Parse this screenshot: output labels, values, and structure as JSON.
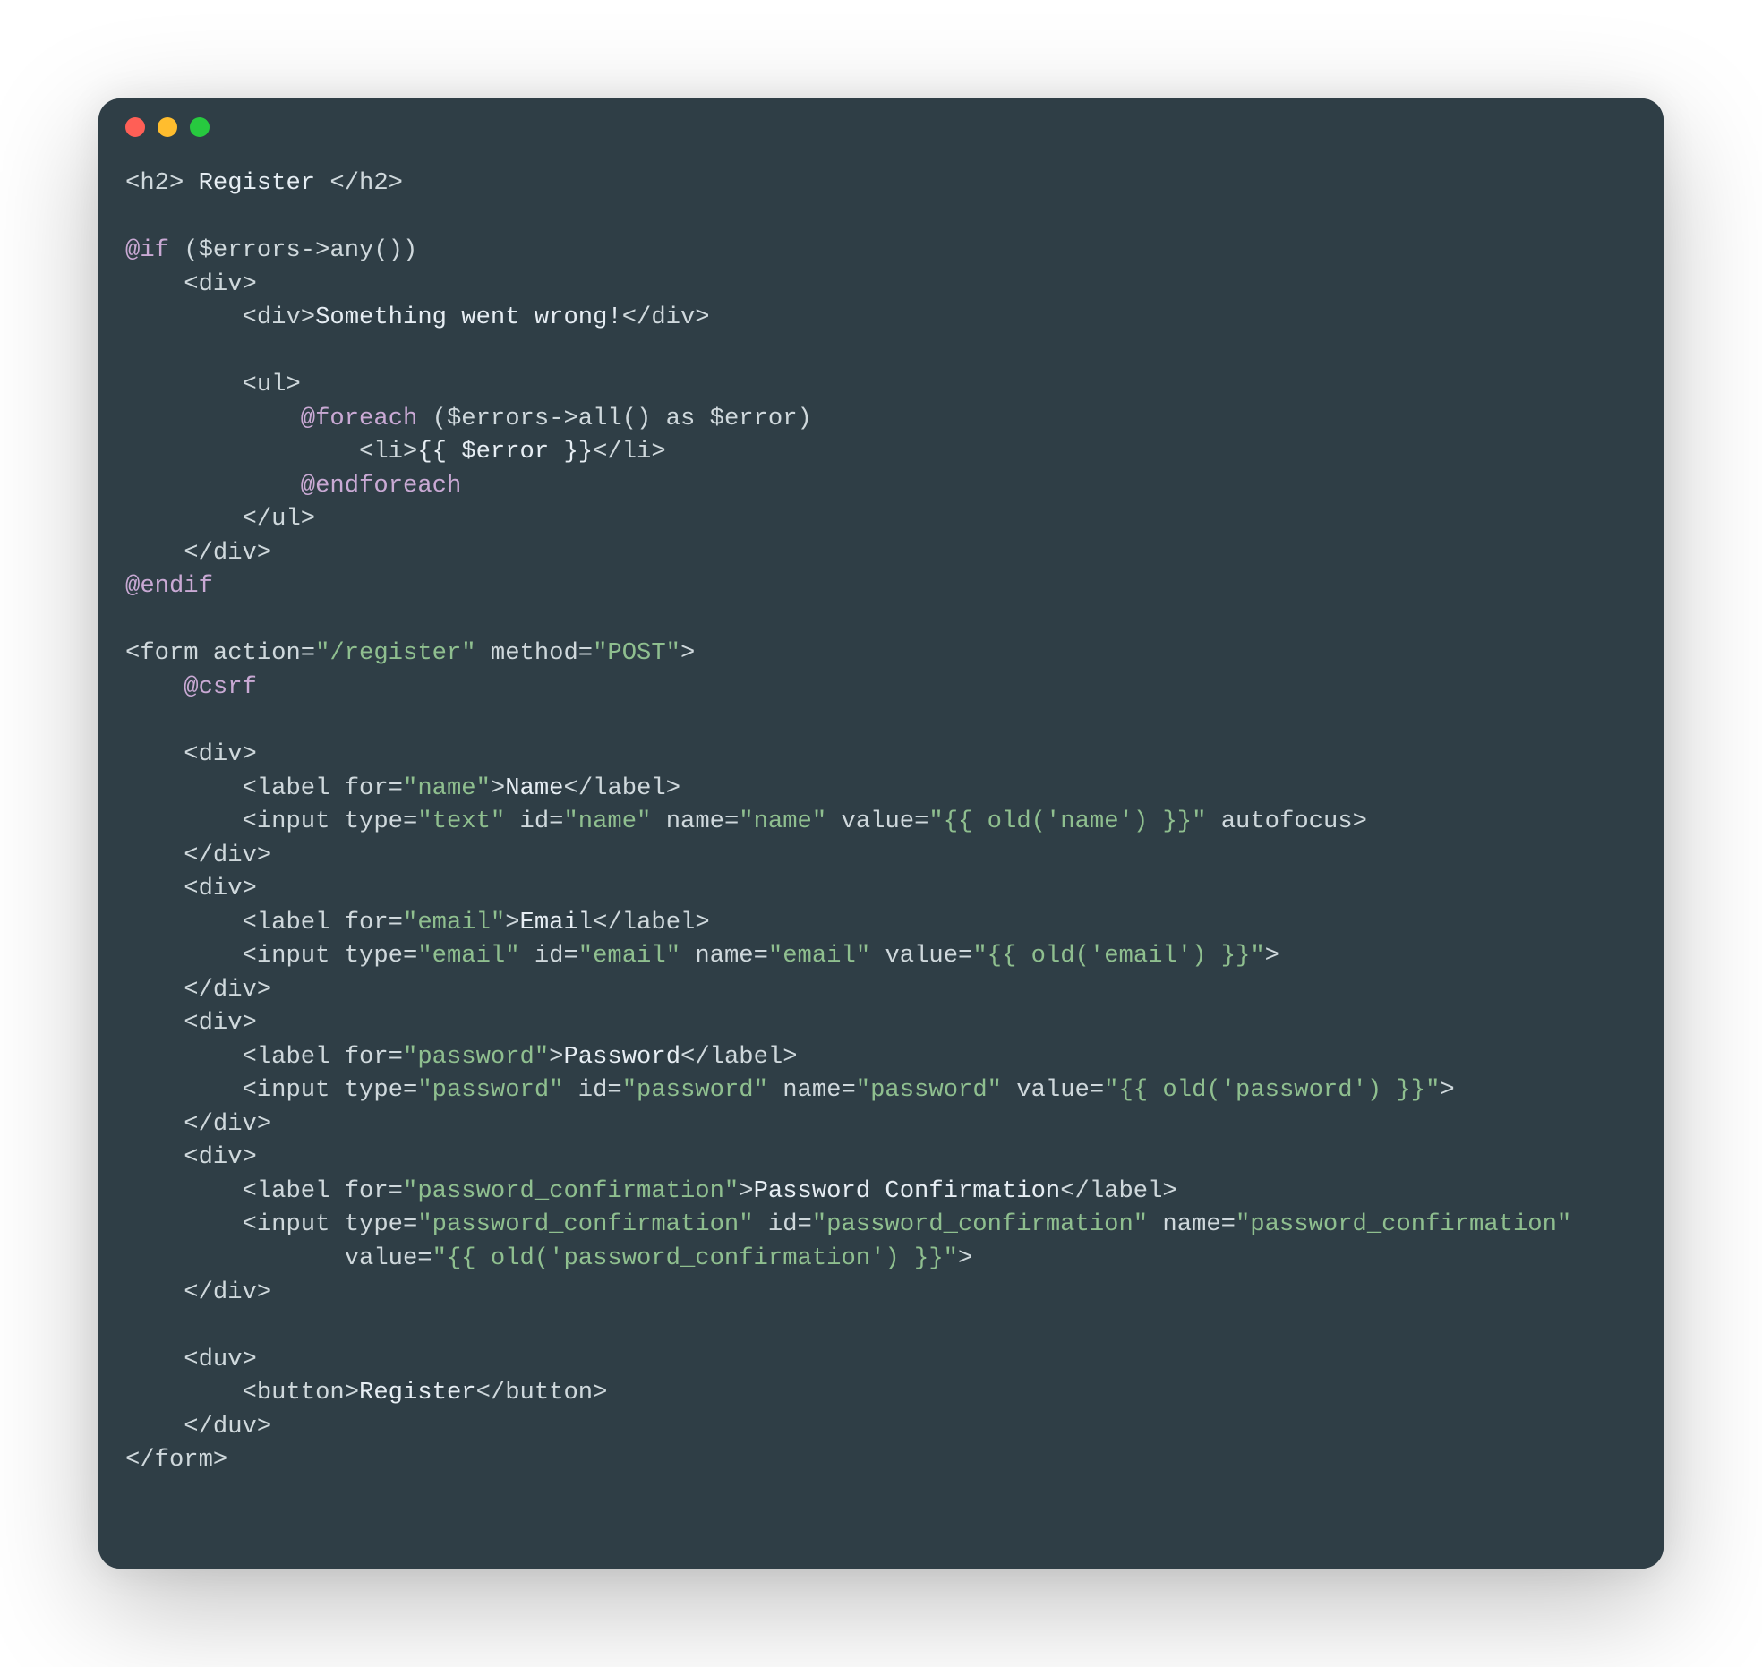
{
  "window": {
    "traffic_lights": [
      "close",
      "minimize",
      "maximize"
    ]
  },
  "code": {
    "lines": [
      [
        {
          "t": "<h2>",
          "c": "c-tag"
        },
        {
          "t": " Register ",
          "c": "c-white"
        },
        {
          "t": "</h2>",
          "c": "c-tag"
        }
      ],
      [],
      [
        {
          "t": "@if",
          "c": "c-dir"
        },
        {
          "t": " ($errors->any())",
          "c": "c-default"
        }
      ],
      [
        {
          "t": "    <div>",
          "c": "c-tag"
        }
      ],
      [
        {
          "t": "        <div>",
          "c": "c-tag"
        },
        {
          "t": "Something went wrong!",
          "c": "c-white"
        },
        {
          "t": "</div>",
          "c": "c-tag"
        }
      ],
      [],
      [
        {
          "t": "        <ul>",
          "c": "c-tag"
        }
      ],
      [
        {
          "t": "            ",
          "c": "c-default"
        },
        {
          "t": "@foreach",
          "c": "c-dir"
        },
        {
          "t": " ($errors->all() as $error)",
          "c": "c-default"
        }
      ],
      [
        {
          "t": "                <li>",
          "c": "c-tag"
        },
        {
          "t": "{{ $error }}",
          "c": "c-white"
        },
        {
          "t": "</li>",
          "c": "c-tag"
        }
      ],
      [
        {
          "t": "            ",
          "c": "c-default"
        },
        {
          "t": "@endforeach",
          "c": "c-dir"
        }
      ],
      [
        {
          "t": "        </ul>",
          "c": "c-tag"
        }
      ],
      [
        {
          "t": "    </div>",
          "c": "c-tag"
        }
      ],
      [
        {
          "t": "@endif",
          "c": "c-dir"
        }
      ],
      [],
      [
        {
          "t": "<form action=",
          "c": "c-tag"
        },
        {
          "t": "\"/register\"",
          "c": "c-str"
        },
        {
          "t": " method=",
          "c": "c-attr"
        },
        {
          "t": "\"POST\"",
          "c": "c-str"
        },
        {
          "t": ">",
          "c": "c-tag"
        }
      ],
      [
        {
          "t": "    ",
          "c": "c-default"
        },
        {
          "t": "@csrf",
          "c": "c-dir"
        }
      ],
      [],
      [
        {
          "t": "    <div>",
          "c": "c-tag"
        }
      ],
      [
        {
          "t": "        <label for=",
          "c": "c-tag"
        },
        {
          "t": "\"name\"",
          "c": "c-str"
        },
        {
          "t": ">",
          "c": "c-tag"
        },
        {
          "t": "Name",
          "c": "c-white"
        },
        {
          "t": "</label>",
          "c": "c-tag"
        }
      ],
      [
        {
          "t": "        <input type=",
          "c": "c-tag"
        },
        {
          "t": "\"text\"",
          "c": "c-str"
        },
        {
          "t": " id=",
          "c": "c-attr"
        },
        {
          "t": "\"name\"",
          "c": "c-str"
        },
        {
          "t": " name=",
          "c": "c-attr"
        },
        {
          "t": "\"name\"",
          "c": "c-str"
        },
        {
          "t": " value=",
          "c": "c-attr"
        },
        {
          "t": "\"{{ old('name') }}\"",
          "c": "c-str"
        },
        {
          "t": " autofocus>",
          "c": "c-tag"
        }
      ],
      [
        {
          "t": "    </div>",
          "c": "c-tag"
        }
      ],
      [
        {
          "t": "    <div>",
          "c": "c-tag"
        }
      ],
      [
        {
          "t": "        <label for=",
          "c": "c-tag"
        },
        {
          "t": "\"email\"",
          "c": "c-str"
        },
        {
          "t": ">",
          "c": "c-tag"
        },
        {
          "t": "Email",
          "c": "c-white"
        },
        {
          "t": "</label>",
          "c": "c-tag"
        }
      ],
      [
        {
          "t": "        <input type=",
          "c": "c-tag"
        },
        {
          "t": "\"email\"",
          "c": "c-str"
        },
        {
          "t": " id=",
          "c": "c-attr"
        },
        {
          "t": "\"email\"",
          "c": "c-str"
        },
        {
          "t": " name=",
          "c": "c-attr"
        },
        {
          "t": "\"email\"",
          "c": "c-str"
        },
        {
          "t": " value=",
          "c": "c-attr"
        },
        {
          "t": "\"{{ old('email') }}\"",
          "c": "c-str"
        },
        {
          "t": ">",
          "c": "c-tag"
        }
      ],
      [
        {
          "t": "    </div>",
          "c": "c-tag"
        }
      ],
      [
        {
          "t": "    <div>",
          "c": "c-tag"
        }
      ],
      [
        {
          "t": "        <label for=",
          "c": "c-tag"
        },
        {
          "t": "\"password\"",
          "c": "c-str"
        },
        {
          "t": ">",
          "c": "c-tag"
        },
        {
          "t": "Password",
          "c": "c-white"
        },
        {
          "t": "</label>",
          "c": "c-tag"
        }
      ],
      [
        {
          "t": "        <input type=",
          "c": "c-tag"
        },
        {
          "t": "\"password\"",
          "c": "c-str"
        },
        {
          "t": " id=",
          "c": "c-attr"
        },
        {
          "t": "\"password\"",
          "c": "c-str"
        },
        {
          "t": " name=",
          "c": "c-attr"
        },
        {
          "t": "\"password\"",
          "c": "c-str"
        },
        {
          "t": " value=",
          "c": "c-attr"
        },
        {
          "t": "\"{{ old('password') }}\"",
          "c": "c-str"
        },
        {
          "t": ">",
          "c": "c-tag"
        }
      ],
      [
        {
          "t": "    </div>",
          "c": "c-tag"
        }
      ],
      [
        {
          "t": "    <div>",
          "c": "c-tag"
        }
      ],
      [
        {
          "t": "        <label for=",
          "c": "c-tag"
        },
        {
          "t": "\"password_confirmation\"",
          "c": "c-str"
        },
        {
          "t": ">",
          "c": "c-tag"
        },
        {
          "t": "Password Confirmation",
          "c": "c-white"
        },
        {
          "t": "</label>",
          "c": "c-tag"
        }
      ],
      [
        {
          "t": "        <input type=",
          "c": "c-tag"
        },
        {
          "t": "\"password_confirmation\"",
          "c": "c-str"
        },
        {
          "t": " id=",
          "c": "c-attr"
        },
        {
          "t": "\"password_confirmation\"",
          "c": "c-str"
        },
        {
          "t": " name=",
          "c": "c-attr"
        },
        {
          "t": "\"password_confirmation\"",
          "c": "c-str"
        }
      ],
      [
        {
          "t": "               value=",
          "c": "c-attr"
        },
        {
          "t": "\"{{ old('password_confirmation') }}\"",
          "c": "c-str"
        },
        {
          "t": ">",
          "c": "c-tag"
        }
      ],
      [
        {
          "t": "    </div>",
          "c": "c-tag"
        }
      ],
      [],
      [
        {
          "t": "    <duv>",
          "c": "c-tag"
        }
      ],
      [
        {
          "t": "        <button>",
          "c": "c-tag"
        },
        {
          "t": "Register",
          "c": "c-white"
        },
        {
          "t": "</button>",
          "c": "c-tag"
        }
      ],
      [
        {
          "t": "    </duv>",
          "c": "c-tag"
        }
      ],
      [
        {
          "t": "</form>",
          "c": "c-tag"
        }
      ]
    ]
  }
}
